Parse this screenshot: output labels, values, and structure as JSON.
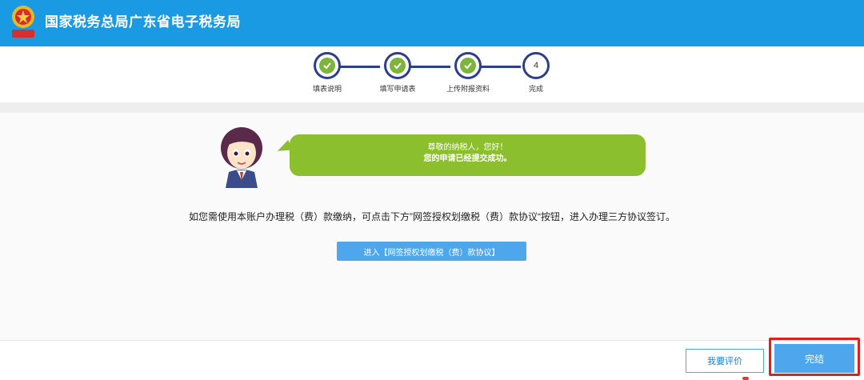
{
  "header": {
    "title": "国家税务总局广东省电子税务局",
    "logo_icon": "tax-emblem-icon"
  },
  "steps": [
    {
      "label": "填表说明",
      "status": "done"
    },
    {
      "label": "填写申请表",
      "status": "done"
    },
    {
      "label": "上传附报资料",
      "status": "done"
    },
    {
      "label": "完成",
      "status": "current",
      "number": "4"
    }
  ],
  "message": {
    "greeting": "尊敬的纳税人，您好！",
    "body": "您的申请已经提交成功。"
  },
  "notice": "如您需使用本账户办理税（费）款缴纳，可点击下方”网签授权划缴税（费）款协议“按钮，进入办理三方协议签订。",
  "agreement_button": "进入【网签授权划缴税（费）款协议】",
  "footer": {
    "rate_label": "我要评价",
    "finish_label": "完结"
  },
  "colors": {
    "header": "#1a9ae3",
    "accent": "#4ea6ec",
    "step": "#2b3f8a",
    "done": "#7db43a",
    "bubble": "#8cbf2e",
    "highlight": "#e02020"
  }
}
